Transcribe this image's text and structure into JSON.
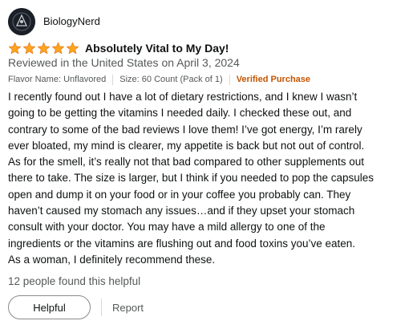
{
  "reviewer": {
    "name": "BiologyNerd",
    "avatar_icon": "reviewer-avatar-icon"
  },
  "rating": {
    "stars": 5,
    "max": 5,
    "star_color": "#ffa41c"
  },
  "review": {
    "title": "Absolutely Vital to My Day!",
    "date": "Reviewed in the United States on April 3, 2024",
    "flavor": "Flavor Name: Unflavored",
    "size": "Size: 60 Count (Pack of 1)",
    "verified": "Verified Purchase",
    "body_lines": [
      "I recently found out I have a lot of dietary restrictions, and I knew I wasn’t",
      "going to be getting the vitamins I needed daily. I checked these out, and",
      "contrary to some of the bad reviews I love them! I’ve got energy, I’m rarely",
      "ever bloated, my mind is clearer, my appetite is back but not out of control.",
      "As for the smell, it’s really not that bad compared to other supplements out",
      "there to take. The size is larger, but I think if you needed to pop the capsules",
      "open and dump it on your food or in your coffee you probably can. They",
      "haven’t caused my stomach any issues…and if they upset your stomach",
      "consult with your doctor. You may have a mild allergy to one of the",
      "ingredients or the vitamins are flushing out and food toxins you’ve eaten.",
      "As a woman, I definitely recommend these."
    ],
    "helpful_count_text": "12 people found this helpful"
  },
  "actions": {
    "helpful_label": "Helpful",
    "report_label": "Report"
  },
  "colors": {
    "verified": "#c45500",
    "secondary_text": "#565959",
    "primary_text": "#0f1111"
  }
}
